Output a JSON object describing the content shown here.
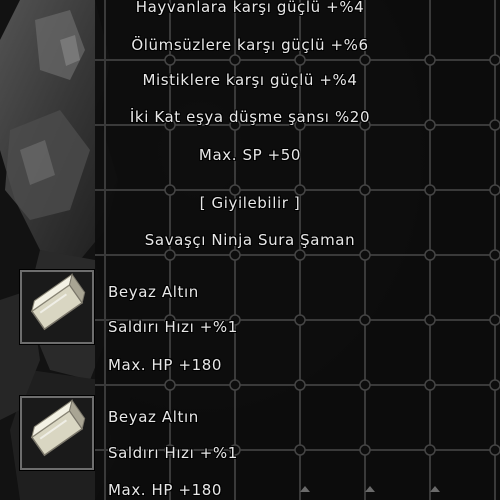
{
  "tooltip": {
    "bonuses": [
      "Hayvanlara karşı güçlü +%4",
      "Ölümsüzlere karşı güçlü +%6",
      "Mistiklere karşı güçlü +%4",
      "İki Kat eşya düşme şansı %20",
      "Max. SP +50"
    ],
    "wearable_label": "[ Giyilebilir ]",
    "classes": "Savaşçı Ninja Sura Şaman",
    "sockets": [
      {
        "icon": "white-gold-stone-icon",
        "name": "Beyaz Altın",
        "stat1": "Saldırı Hızı +%1",
        "stat2": "Max. HP +180"
      },
      {
        "icon": "white-gold-stone-icon",
        "name": "Beyaz Altın",
        "stat1": "Saldırı Hızı +%1",
        "stat2": "Max. HP +180"
      }
    ]
  },
  "colors": {
    "text": "#e8e8e8",
    "grid_line": "#3a3a3a",
    "socket_border": "#6e6e6e"
  }
}
